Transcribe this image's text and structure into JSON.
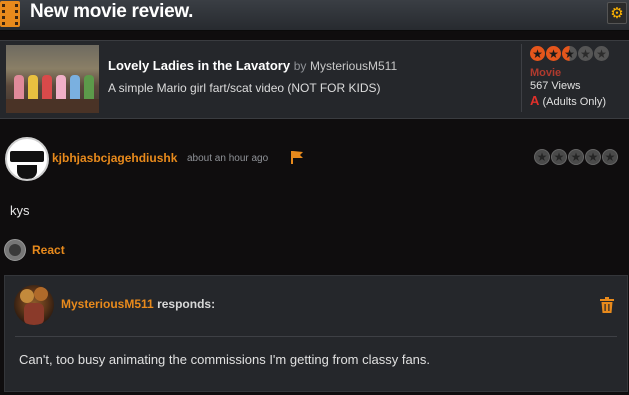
{
  "header": {
    "title": "New movie review.",
    "film_icon": "film-strip-icon",
    "settings_icon": "gear-icon",
    "accent": "#e88a1c"
  },
  "movie": {
    "title": "Lovely Ladies in the Lavatory",
    "by": "by",
    "author": "MysteriousM511",
    "description": "A simple Mario girl fart/scat video (NOT FOR KIDS)",
    "rating_stars": 2.5,
    "rating_max": 5,
    "type": "Movie",
    "views": "567 Views",
    "content_rating_letter": "A",
    "content_rating_label": "(Adults Only)"
  },
  "review": {
    "username": "kjbhjasbcjagehdiushk",
    "time": "about an hour ago",
    "text": "kys",
    "flag_icon": "flag-icon",
    "user_stars": 0,
    "react_label": "React"
  },
  "response": {
    "author": "MysteriousM511",
    "verb": "responds:",
    "text": "Can't, too busy animating the commissions I'm getting from classy fans.",
    "delete_icon": "trash-icon"
  },
  "colors": {
    "background": "#0f0d0e",
    "panel": "#25272b",
    "star_fill": "#e5561c",
    "adult_red": "#e0302a"
  }
}
